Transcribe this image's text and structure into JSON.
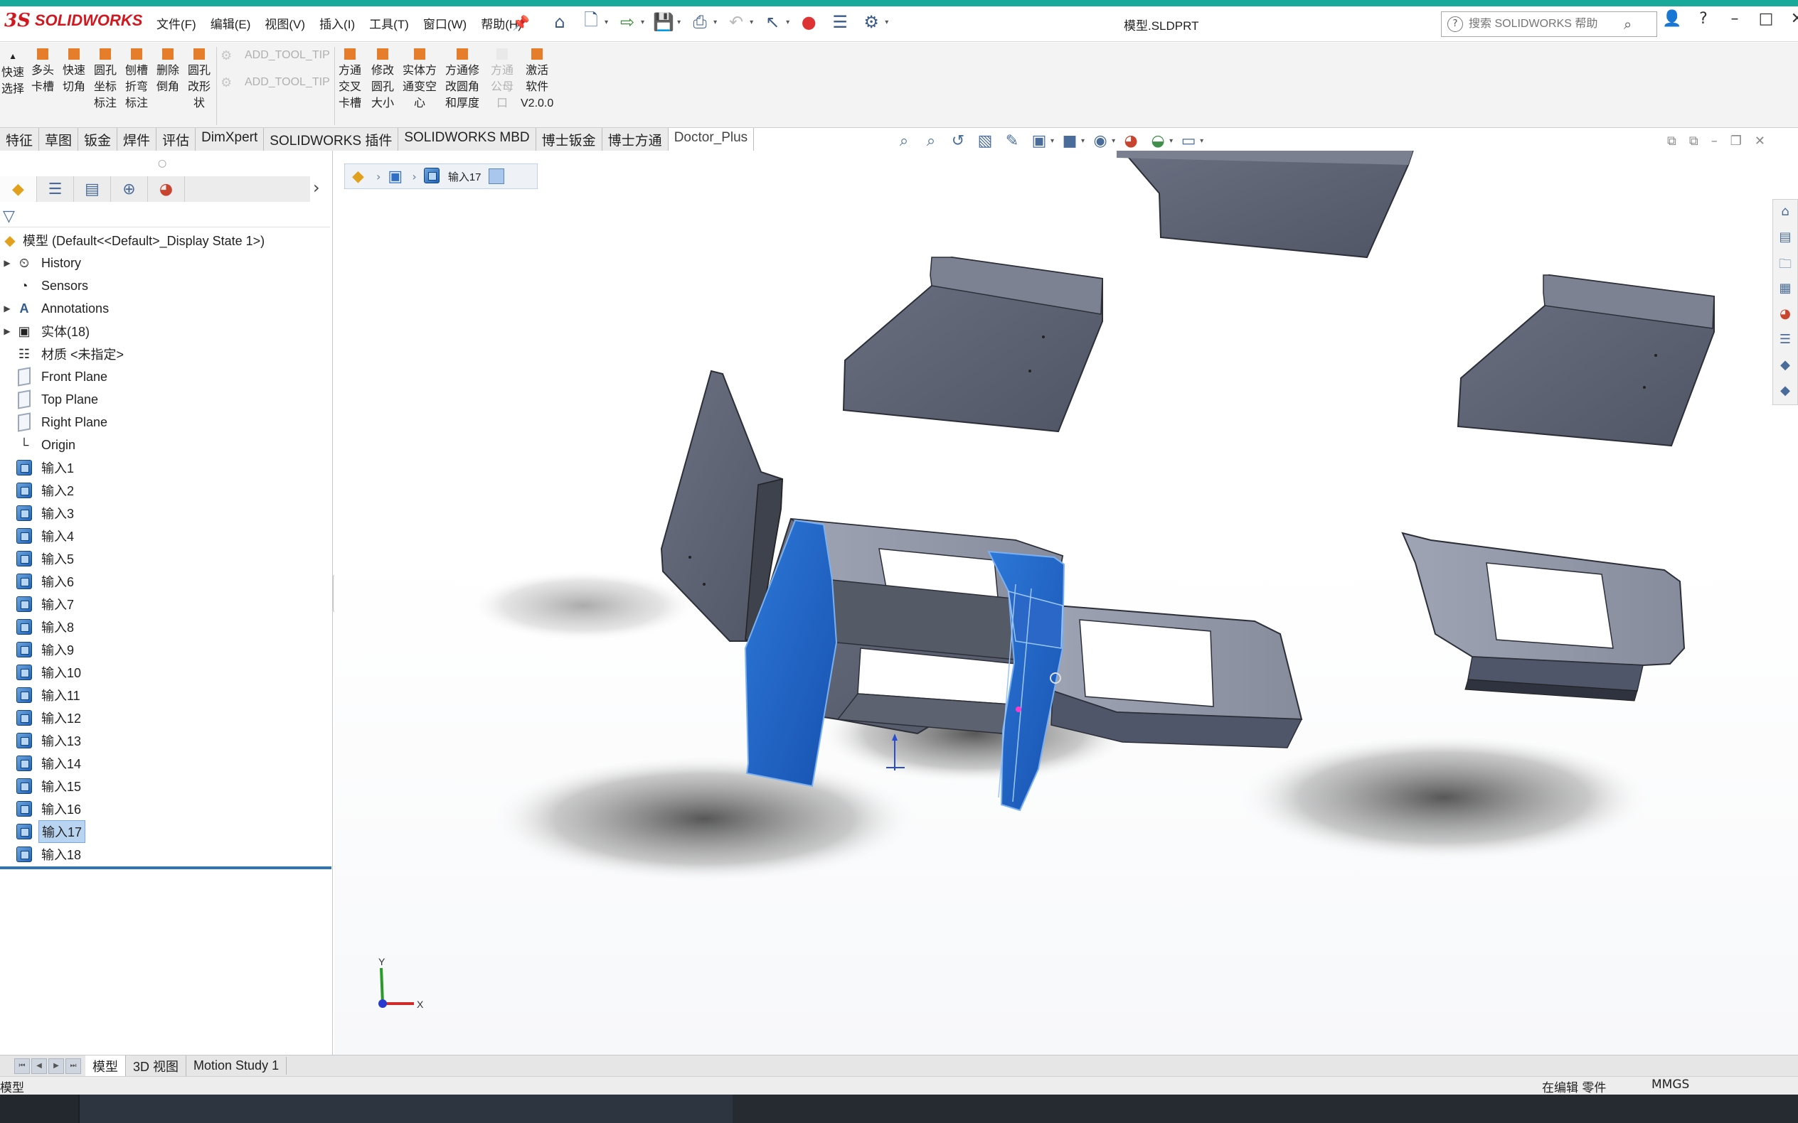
{
  "app": {
    "logo_mark": "3S",
    "logo_name": "SOLIDWORKS",
    "document_title": "模型.SLDPRT",
    "brand_color": "#d3171e",
    "accent_color": "#19a99a"
  },
  "menu": {
    "items": [
      "文件(F)",
      "编辑(E)",
      "视图(V)",
      "插入(I)",
      "工具(T)",
      "窗口(W)",
      "帮助(H)"
    ]
  },
  "quick_access": {
    "icons": [
      "home-icon",
      "new-file-icon",
      "open-icon",
      "save-icon",
      "print-icon",
      "undo-icon",
      "select-arrow-icon",
      "rebuild-icon",
      "file-properties-icon",
      "options-gear-icon"
    ]
  },
  "help_search": {
    "placeholder": "搜索 SOLIDWORKS 帮助"
  },
  "window_controls": {
    "icons": [
      "user-icon",
      "help-icon",
      "minimize-icon",
      "maximize-icon",
      "close-icon"
    ]
  },
  "command_manager": {
    "quick_select": [
      "快速",
      "选择"
    ],
    "tools": [
      [
        "多头",
        "卡槽"
      ],
      [
        "快速",
        "切角"
      ],
      [
        "圆孔",
        "坐标",
        "标注"
      ],
      [
        "刨槽",
        "折弯",
        "标注"
      ],
      [
        "删除",
        "倒角"
      ],
      [
        "圆孔",
        "改形",
        "状"
      ]
    ],
    "add_tool_tips": [
      "ADD_TOOL_TIP",
      "ADD_TOOL_TIP"
    ],
    "tools2": [
      [
        "方通",
        "交叉",
        "卡槽"
      ],
      [
        "修改",
        "圆孔",
        "大小"
      ],
      [
        "实体方",
        "通变空",
        "心"
      ],
      [
        "方通修",
        "改圆角",
        "和厚度"
      ],
      [
        "方通",
        "公母",
        "口"
      ],
      [
        "激活",
        "软件",
        "V2.0.0"
      ]
    ],
    "disabled_tool": "方通公母口"
  },
  "tabs": [
    "特征",
    "草图",
    "钣金",
    "焊件",
    "评估",
    "DimXpert",
    "SOLIDWORKS 插件",
    "SOLIDWORKS MBD",
    "博士钣金",
    "博士方通",
    "Doctor_Plus"
  ],
  "active_tab": "Doctor_Plus",
  "feature_tree": {
    "root": "模型  (Default<<Default>_Display State 1>)",
    "items": [
      {
        "label": "History",
        "icon": "history-icon",
        "expandable": true
      },
      {
        "label": "Sensors",
        "icon": "sensors-icon",
        "expandable": false
      },
      {
        "label": "Annotations",
        "icon": "annotations-icon",
        "expandable": true
      },
      {
        "label": "实体(18)",
        "icon": "solid-bodies-icon",
        "expandable": true
      },
      {
        "label": "材质 <未指定>",
        "icon": "material-icon",
        "expandable": false
      },
      {
        "label": "Front Plane",
        "icon": "plane-icon",
        "expandable": false
      },
      {
        "label": "Top Plane",
        "icon": "plane-icon",
        "expandable": false
      },
      {
        "label": "Right Plane",
        "icon": "plane-icon",
        "expandable": false
      },
      {
        "label": "Origin",
        "icon": "origin-icon",
        "expandable": false
      },
      {
        "label": "输入1",
        "icon": "imported-body-icon",
        "expandable": false
      },
      {
        "label": "输入2",
        "icon": "imported-body-icon",
        "expandable": false
      },
      {
        "label": "输入3",
        "icon": "imported-body-icon",
        "expandable": false
      },
      {
        "label": "输入4",
        "icon": "imported-body-icon",
        "expandable": false
      },
      {
        "label": "输入5",
        "icon": "imported-body-icon",
        "expandable": false
      },
      {
        "label": "输入6",
        "icon": "imported-body-icon",
        "expandable": false
      },
      {
        "label": "输入7",
        "icon": "imported-body-icon",
        "expandable": false
      },
      {
        "label": "输入8",
        "icon": "imported-body-icon",
        "expandable": false
      },
      {
        "label": "输入9",
        "icon": "imported-body-icon",
        "expandable": false
      },
      {
        "label": "输入10",
        "icon": "imported-body-icon",
        "expandable": false
      },
      {
        "label": "输入11",
        "icon": "imported-body-icon",
        "expandable": false
      },
      {
        "label": "输入12",
        "icon": "imported-body-icon",
        "expandable": false
      },
      {
        "label": "输入13",
        "icon": "imported-body-icon",
        "expandable": false
      },
      {
        "label": "输入14",
        "icon": "imported-body-icon",
        "expandable": false
      },
      {
        "label": "输入15",
        "icon": "imported-body-icon",
        "expandable": false
      },
      {
        "label": "输入16",
        "icon": "imported-body-icon",
        "expandable": false
      },
      {
        "label": "输入17",
        "icon": "imported-body-icon",
        "expandable": false,
        "selected": true
      },
      {
        "label": "输入18",
        "icon": "imported-body-icon",
        "expandable": false
      }
    ]
  },
  "breadcrumb": {
    "current": "输入17"
  },
  "viewport": {
    "selection_color": "#1e63c7",
    "body_color": "#5b6172",
    "triad": [
      "X",
      "Y"
    ]
  },
  "bottom_tabs": [
    "模型",
    "3D 视图",
    "Motion Study 1"
  ],
  "active_bottom_tab": "模型",
  "status": {
    "left": "模型",
    "mode": "在编辑 零件",
    "units": "MMGS"
  }
}
